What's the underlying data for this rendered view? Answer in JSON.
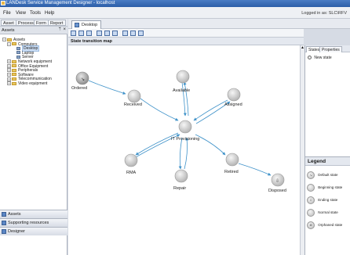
{
  "window": {
    "title": "LANDesk Service Management Designer - localhost",
    "logged_in": "Logged in as: SLC\\RFV"
  },
  "menu": [
    "File",
    "View",
    "Tools",
    "Help"
  ],
  "left_tabs": [
    "Asset",
    "Process",
    "Form",
    "Report"
  ],
  "left_panel": {
    "title": "Assets",
    "tree": [
      {
        "label": "Assets",
        "level": 0,
        "kind": "root"
      },
      {
        "label": "Computers",
        "level": 1,
        "kind": "folder"
      },
      {
        "label": "Desktop",
        "level": 2,
        "kind": "device",
        "selected": true
      },
      {
        "label": "Laptop",
        "level": 2,
        "kind": "device"
      },
      {
        "label": "Server",
        "level": 2,
        "kind": "device"
      },
      {
        "label": "Network equipment",
        "level": 1,
        "kind": "folder"
      },
      {
        "label": "Office Equipment",
        "level": 1,
        "kind": "folder"
      },
      {
        "label": "Peripherals",
        "level": 1,
        "kind": "folder"
      },
      {
        "label": "Software",
        "level": 1,
        "kind": "folder"
      },
      {
        "label": "Telecommunication",
        "level": 1,
        "kind": "folder"
      },
      {
        "label": "Video equipment",
        "level": 1,
        "kind": "folder"
      }
    ],
    "nav_buttons": [
      "Assets",
      "Supporting resources",
      "Designer"
    ]
  },
  "doc_tab": "Desktop",
  "section_title": "State transition map",
  "right_panel": {
    "tabs": [
      "States",
      "Properties"
    ],
    "new_state": "New state"
  },
  "legend": {
    "title": "Legend",
    "items": [
      {
        "label": "Default state",
        "glyph": "↘"
      },
      {
        "label": "Beginning state",
        "glyph": ""
      },
      {
        "label": "Ending state",
        "glyph": "⇩"
      },
      {
        "label": "Normal state",
        "glyph": ""
      },
      {
        "label": "Orphaned state",
        "glyph": "⊗"
      }
    ]
  },
  "diagram": {
    "nodes": [
      {
        "id": "ordered",
        "label": "Ordered",
        "kind": "default"
      },
      {
        "id": "received",
        "label": "Received",
        "kind": "normal"
      },
      {
        "id": "available",
        "label": "Available",
        "kind": "normal"
      },
      {
        "id": "assigned",
        "label": "Assigned",
        "kind": "normal"
      },
      {
        "id": "it",
        "label": "IT Provisioning",
        "kind": "normal"
      },
      {
        "id": "rma",
        "label": "RMA",
        "kind": "normal"
      },
      {
        "id": "repair",
        "label": "Repair",
        "kind": "normal"
      },
      {
        "id": "retired",
        "label": "Retired",
        "kind": "normal"
      },
      {
        "id": "disposed",
        "label": "Disposed",
        "kind": "ending"
      }
    ],
    "colors": {
      "arrow": "#3f92c9",
      "node": "#c4c4c4"
    }
  }
}
